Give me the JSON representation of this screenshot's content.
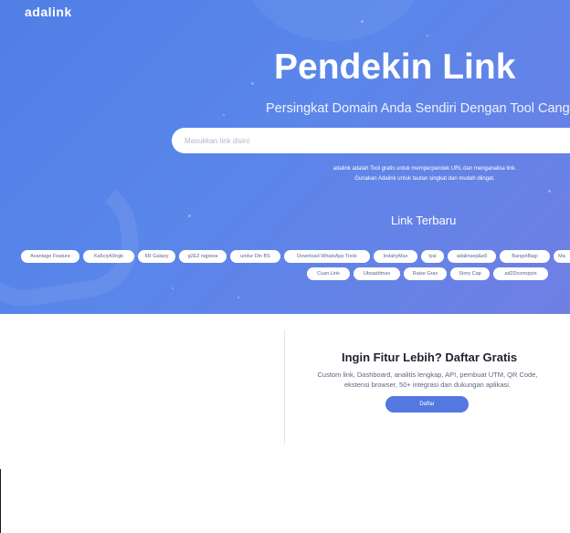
{
  "brand": {
    "name": "adalink"
  },
  "hero": {
    "title": "Pendekin Link",
    "subtitle": "Persingkat Domain Anda Sendiri Dengan Tool Cang",
    "search_placeholder": "Masukkan link disini",
    "description": "adalink adalah Tool gratis untuk memperpendek URL dan menganalisa link. Gunakan Adalink untuk tautan singkat dan mudah diingat."
  },
  "recent": {
    "title": "Link Terbaru",
    "items": [
      "Avantage Feature",
      "Ka5ciyK0ngk",
      "IIR Galaxy",
      "g2E2 nqpeea",
      "undur Din BS",
      "Download WhatsApp Tools",
      "IndahyMax",
      "lyal",
      "adalinsep&e8",
      "BangetBagi",
      "Ma",
      "Cuan.Link",
      "Ubsaddmax",
      "Raise Grax",
      "Story Cap",
      "ad2Dconnpyts"
    ]
  },
  "promo": {
    "title": "Ingin Fitur Lebih? Daftar Gratis",
    "text": "Custom link, Dashboard, analitis lengkap, API, pembuat UTM, QR Code, ekstensi browser, 50+ integrasi dan dukungan aplikasi.",
    "button_label": "Daftar"
  },
  "colors": {
    "hero": "#5a86ea",
    "accent": "#5577e0"
  }
}
